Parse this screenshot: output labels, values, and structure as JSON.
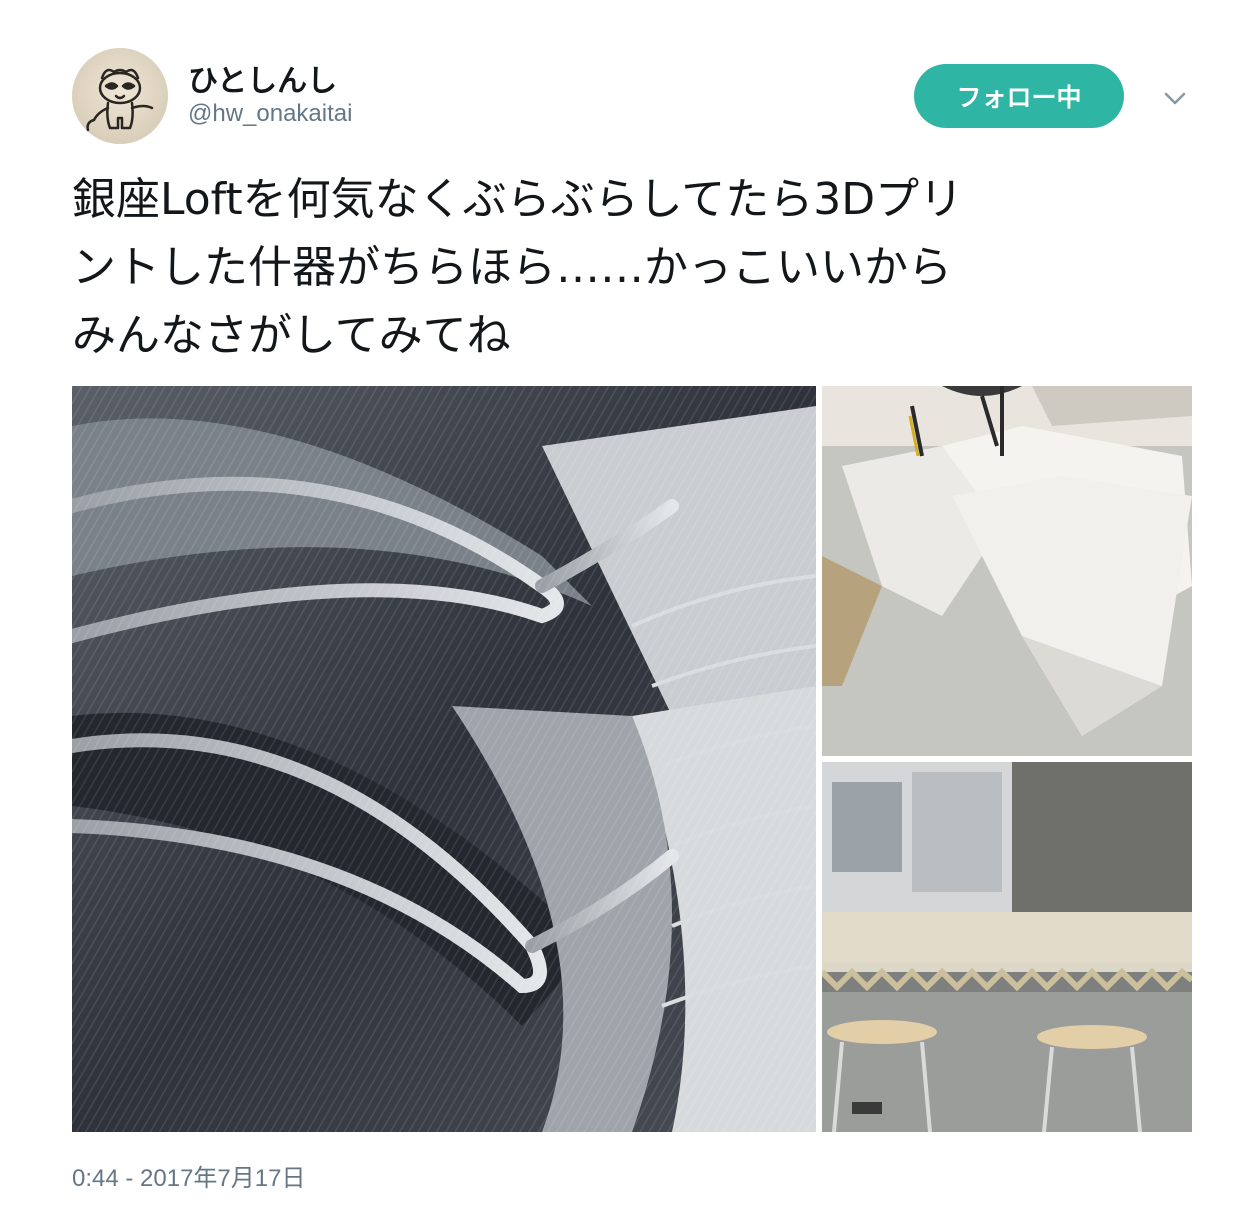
{
  "tweet": {
    "display_name": "ひとしんし",
    "handle": "@hw_onakaitai",
    "follow_button_label": "フォロー中",
    "menu_icon": "chevron-down-icon",
    "text_lines": [
      "銀座Loftを何気なくぶらぶらしてたら3Dプリ",
      "ントした什器がちらほら……かっこいいから",
      "みんなさがしてみてね"
    ],
    "timestamp": "0:44 - 2017年7月17日"
  },
  "colors": {
    "follow_button_bg": "#2fb5a3",
    "secondary_text": "#657786",
    "primary_text": "#14171a"
  }
}
